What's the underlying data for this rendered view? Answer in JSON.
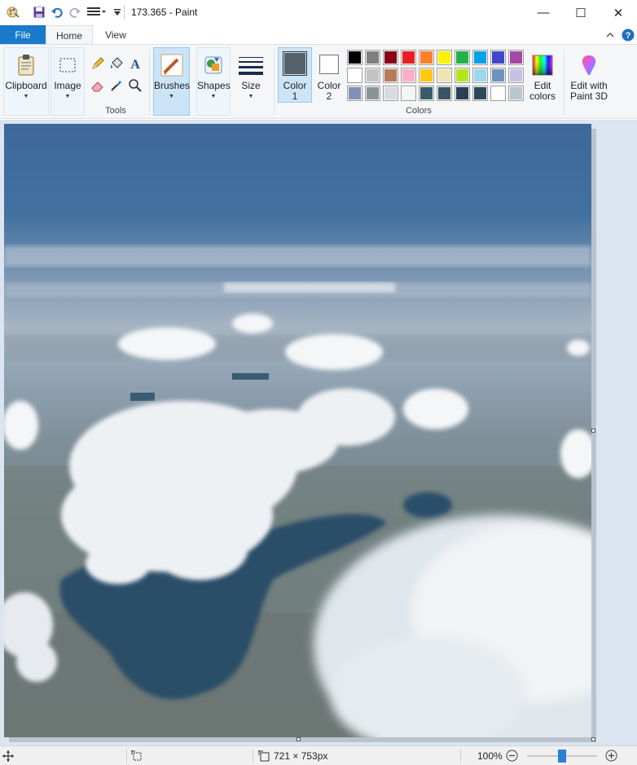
{
  "window": {
    "title": "173.365 - Paint",
    "buttons": {
      "minimize": "—",
      "maximize": "☐",
      "close": "✕"
    }
  },
  "quick_access": [
    "paint-app-icon",
    "save-icon",
    "undo-icon",
    "redo-icon",
    "customize-icon"
  ],
  "tabs": {
    "file": "File",
    "home": "Home",
    "view": "View"
  },
  "ribbon": {
    "clipboard": "Clipboard",
    "image": "Image",
    "tools": "Tools",
    "brushes": "Brushes",
    "shapes": "Shapes",
    "size": "Size",
    "color1_line1": "Color",
    "color1_line2": "1",
    "color2_line1": "Color",
    "color2_line2": "2",
    "colors_group": "Colors",
    "edit_colors_line1": "Edit",
    "edit_colors_line2": "colors",
    "paint3d_line1": "Edit with",
    "paint3d_line2": "Paint 3D"
  },
  "colors": {
    "color1": "#56626b",
    "color2": "#ffffff",
    "palette_row1": [
      "#000000",
      "#7f7f7f",
      "#880015",
      "#ed1c24",
      "#ff7f27",
      "#fff200",
      "#22b14c",
      "#00a2e8",
      "#3f48cc",
      "#a349a4"
    ],
    "palette_row2": [
      "#ffffff",
      "#c3c3c3",
      "#b97a57",
      "#ffaec9",
      "#ffc90e",
      "#efe4b0",
      "#b5e61d",
      "#99d9ea",
      "#7092be",
      "#c8bfe7"
    ],
    "palette_row3": [
      "#8092b3",
      "#8a9396",
      "#d8dbdd",
      "#f4f4f4",
      "#3b5a6a",
      "#3a5466",
      "#2b3f57",
      "#2a4a5c",
      "#ffffff",
      "#b9c4cc"
    ]
  },
  "status": {
    "image_size": "721 × 753px",
    "zoom": "100%",
    "zoom_level": 0.5
  }
}
